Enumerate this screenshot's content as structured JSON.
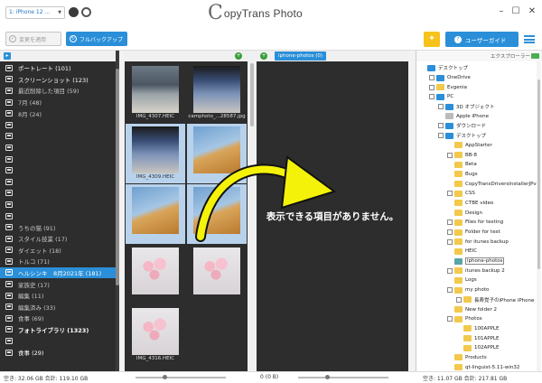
{
  "app": {
    "logo_letter": "C",
    "title": "opyTrans Photo"
  },
  "device": {
    "selected": "1: iPhone 12 ..."
  },
  "toolbar": {
    "apply_label": "変更を適用",
    "backup_label": "フルバックアップ",
    "guide_label": "ユーザーガイド"
  },
  "albums": [
    {
      "label": "ポートレート (101)",
      "style": "white"
    },
    {
      "label": "スクリーンショット (123)",
      "style": "white"
    },
    {
      "label": "最近削除した項目 (59)",
      "style": ""
    },
    {
      "label": "7月 (48)",
      "style": ""
    },
    {
      "label": "8月 (24)",
      "style": ""
    },
    {
      "label": "",
      "style": ""
    },
    {
      "label": "",
      "style": ""
    },
    {
      "label": "",
      "style": ""
    },
    {
      "label": "",
      "style": ""
    },
    {
      "label": "",
      "style": ""
    },
    {
      "label": "",
      "style": ""
    },
    {
      "label": "",
      "style": ""
    },
    {
      "label": "",
      "style": ""
    },
    {
      "label": "",
      "style": ""
    },
    {
      "label": "うちの猫 (91)",
      "style": ""
    },
    {
      "label": "スタイル技業 (17)",
      "style": ""
    },
    {
      "label": "ダイエット (18)",
      "style": ""
    },
    {
      "label": "トルコ (71)",
      "style": ""
    },
    {
      "label": "ヘルシンキ　8月2021年 (181)",
      "style": "selected"
    },
    {
      "label": "家族史 (17)",
      "style": ""
    },
    {
      "label": "編集 (11)",
      "style": ""
    },
    {
      "label": "編集済み (33)",
      "style": ""
    },
    {
      "label": "食事 (69)",
      "style": ""
    },
    {
      "label": "フォトライブラリ (1323)",
      "style": "bold"
    },
    {
      "label": "",
      "style": ""
    },
    {
      "label": "食事 (29)",
      "style": "white"
    }
  ],
  "thumbnails": [
    {
      "caption": "IMG_4307.HEIC",
      "kind": "airport",
      "selected": false
    },
    {
      "caption": "camphoto_...28587.jpg",
      "kind": "screen",
      "selected": false
    },
    {
      "caption": "IMG_4309.HEIC",
      "kind": "screen",
      "selected": true
    },
    {
      "caption": "",
      "kind": "wing",
      "selected": true
    },
    {
      "caption": "",
      "kind": "wing",
      "selected": true
    },
    {
      "caption": "",
      "kind": "wing",
      "selected": true
    },
    {
      "caption": "",
      "kind": "roses",
      "selected": false
    },
    {
      "caption": "",
      "kind": "roses",
      "selected": false
    },
    {
      "caption": "IMG_4316.HEIC",
      "kind": "roses",
      "selected": false
    }
  ],
  "middle": {
    "tab_label": "iphone-photos (0)",
    "explorer_label": "エクスプローラー",
    "empty_message": "表示できる項目がありません。"
  },
  "tree": [
    {
      "label": "デスクトップ",
      "depth": 0,
      "icon": "blue",
      "exp": false
    },
    {
      "label": "OneDrive",
      "depth": 1,
      "icon": "blue",
      "exp": true
    },
    {
      "label": "Evgenia",
      "depth": 1,
      "icon": "yellow",
      "exp": true
    },
    {
      "label": "PC",
      "depth": 1,
      "icon": "blue",
      "exp": true
    },
    {
      "label": "3D オブジェクト",
      "depth": 2,
      "icon": "blue",
      "exp": true
    },
    {
      "label": "Apple iPhone",
      "depth": 2,
      "icon": "gray",
      "exp": false
    },
    {
      "label": "ダウンロード",
      "depth": 2,
      "icon": "blue",
      "exp": true
    },
    {
      "label": "デスクトップ",
      "depth": 2,
      "icon": "blue",
      "exp": true
    },
    {
      "label": "AppStarter",
      "depth": 3,
      "icon": "yellow",
      "exp": false
    },
    {
      "label": "BB-8",
      "depth": 3,
      "icon": "yellow",
      "exp": true
    },
    {
      "label": "Beta",
      "depth": 3,
      "icon": "yellow",
      "exp": false
    },
    {
      "label": "Bugs",
      "depth": 3,
      "icon": "yellow",
      "exp": false
    },
    {
      "label": "CopyTransDriversInstallerJPv3",
      "depth": 3,
      "icon": "yellow",
      "exp": false
    },
    {
      "label": "CSS",
      "depth": 3,
      "icon": "yellow",
      "exp": true
    },
    {
      "label": "CTBE video",
      "depth": 3,
      "icon": "yellow",
      "exp": false
    },
    {
      "label": "Design",
      "depth": 3,
      "icon": "yellow",
      "exp": false
    },
    {
      "label": "Files for testing",
      "depth": 3,
      "icon": "yellow",
      "exp": true
    },
    {
      "label": "Folder for test",
      "depth": 3,
      "icon": "yellow",
      "exp": true
    },
    {
      "label": "for itunes backup",
      "depth": 3,
      "icon": "yellow",
      "exp": true
    },
    {
      "label": "HEIC",
      "depth": 3,
      "icon": "yellow",
      "exp": false
    },
    {
      "label": "iphone-photos",
      "depth": 3,
      "icon": "teal",
      "exp": false,
      "current": true
    },
    {
      "label": "itunes backup 2",
      "depth": 3,
      "icon": "yellow",
      "exp": true
    },
    {
      "label": "Logs",
      "depth": 3,
      "icon": "yellow",
      "exp": false
    },
    {
      "label": "my photo",
      "depth": 3,
      "icon": "yellow",
      "exp": true
    },
    {
      "label": "長寿覚子のiPhone iPhone",
      "depth": 4,
      "icon": "yellow",
      "exp": true
    },
    {
      "label": "New folder 2",
      "depth": 3,
      "icon": "yellow",
      "exp": false
    },
    {
      "label": "Photos",
      "depth": 3,
      "icon": "yellow",
      "exp": true
    },
    {
      "label": "100APPLE",
      "depth": 4,
      "icon": "yellow",
      "exp": false
    },
    {
      "label": "101APPLE",
      "depth": 4,
      "icon": "yellow",
      "exp": false
    },
    {
      "label": "102APPLE",
      "depth": 4,
      "icon": "yellow",
      "exp": false
    },
    {
      "label": "Products",
      "depth": 3,
      "icon": "yellow",
      "exp": false
    },
    {
      "label": "qt-linguist-5.11-win32",
      "depth": 3,
      "icon": "yellow",
      "exp": false
    },
    {
      "label": "quicktext",
      "depth": 3,
      "icon": "yellow",
      "exp": false
    },
    {
      "label": "res",
      "depth": 3,
      "icon": "yellow",
      "exp": false
    }
  ],
  "status": {
    "left": "空き: 32.06 GB 合計: 119.10 GB",
    "middle": "0 (0 B)",
    "right": "空き: 11.07 GB 合計: 217.81 GB"
  },
  "colors": {
    "accent": "#2a8fd8",
    "dark_panel": "#2d2d2d",
    "bulb": "#f6c21b",
    "arrow": "#f5f20a"
  }
}
